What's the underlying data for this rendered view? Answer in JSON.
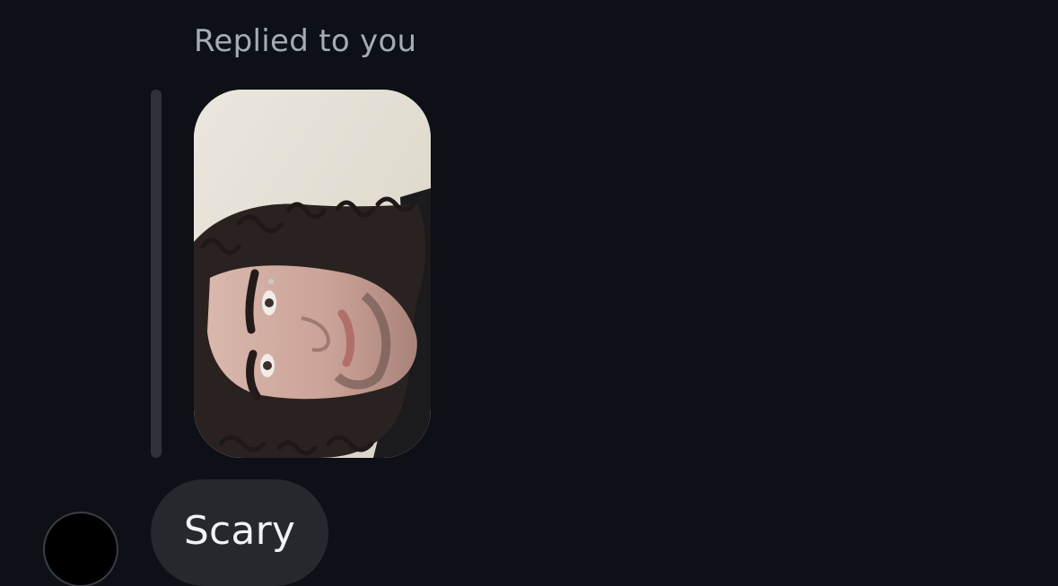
{
  "reply": {
    "label": "Replied to you"
  },
  "media": {
    "icon": "photo-icon"
  },
  "message": {
    "text": "Scary"
  },
  "colors": {
    "background": "#0d1016",
    "reply_label": "#a7abb2",
    "reply_bar": "#2f3237",
    "bubble": "#25282d",
    "bubble_text": "#f1f2f4"
  }
}
